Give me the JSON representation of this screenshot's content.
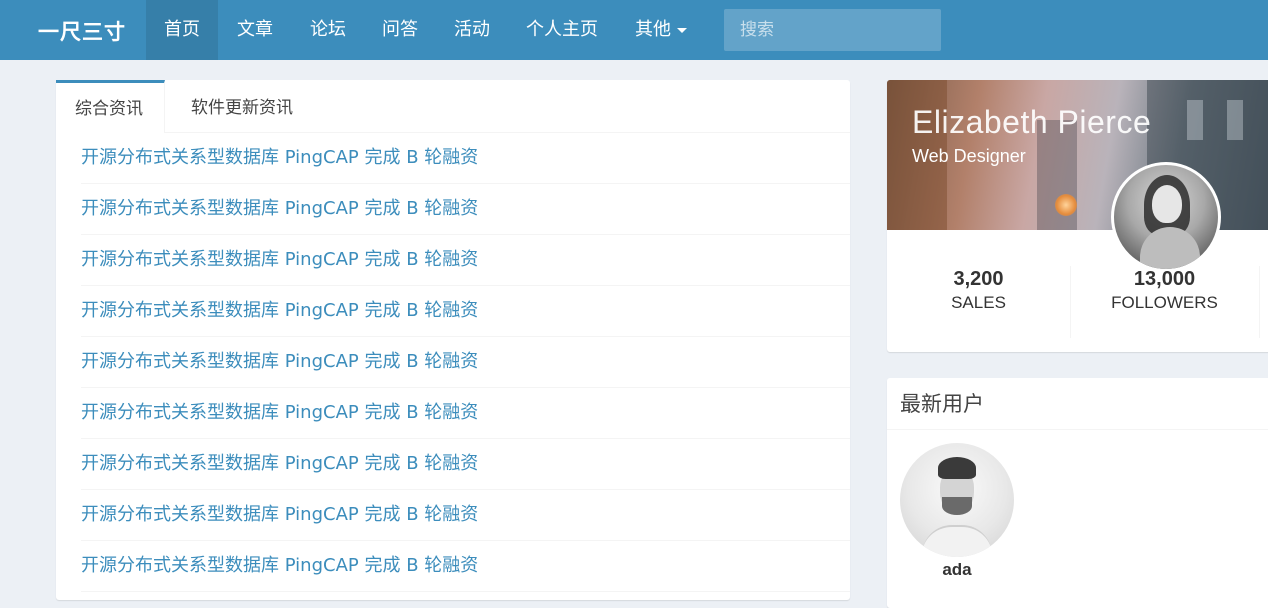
{
  "navbar": {
    "brand": "一尺三寸",
    "items": [
      {
        "label": "首页",
        "active": true
      },
      {
        "label": "文章"
      },
      {
        "label": "论坛"
      },
      {
        "label": "问答"
      },
      {
        "label": "活动"
      },
      {
        "label": "个人主页"
      },
      {
        "label": "其他",
        "dropdown": true
      }
    ],
    "search_placeholder": "搜索",
    "colors": {
      "navbar": "#3c8dbc",
      "active": "#367fa9"
    }
  },
  "news": {
    "tabs": [
      {
        "label": "综合资讯",
        "active": true
      },
      {
        "label": "软件更新资讯"
      }
    ],
    "items": [
      "开源分布式关系型数据库 PingCAP 完成 B 轮融资",
      "开源分布式关系型数据库 PingCAP 完成 B 轮融资",
      "开源分布式关系型数据库 PingCAP 完成 B 轮融资",
      "开源分布式关系型数据库 PingCAP 完成 B 轮融资",
      "开源分布式关系型数据库 PingCAP 完成 B 轮融资",
      "开源分布式关系型数据库 PingCAP 完成 B 轮融资",
      "开源分布式关系型数据库 PingCAP 完成 B 轮融资",
      "开源分布式关系型数据库 PingCAP 完成 B 轮融资",
      "开源分布式关系型数据库 PingCAP 完成 B 轮融资"
    ],
    "link_color": "#3c8dbc"
  },
  "profile": {
    "name": "Elizabeth Pierce",
    "role": "Web Designer",
    "stats": [
      {
        "value": "3,200",
        "label": "SALES"
      },
      {
        "value": "13,000",
        "label": "FOLLOWERS"
      }
    ]
  },
  "latest_users": {
    "title": "最新用户",
    "users": [
      {
        "name": "ada"
      }
    ]
  }
}
